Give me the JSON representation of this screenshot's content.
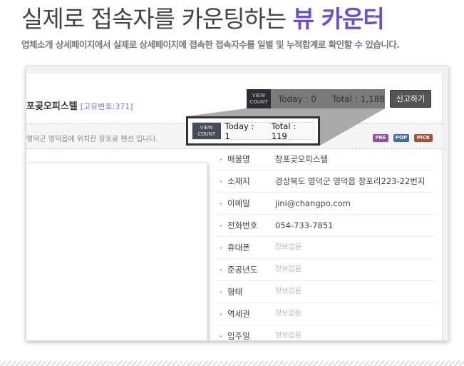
{
  "header": {
    "title_main": "실제로 접속자를 카운팅하는 ",
    "title_accent": "뷰 카운터",
    "subtitle": "업체소개 상세페이지에서 실제로 상세페이지에 접속한 접속자수를 일별 및 누적합계로 확인할 수 있습니다."
  },
  "listing": {
    "name": "포곶오피스텔",
    "id_label": "[고유번호:371]",
    "description": "영덕군 영덕읍에 위치한 창포곶 펜션 입니다.",
    "report_button": "신고하기",
    "badges": [
      {
        "label": "PRE",
        "color": "#8a4fb0"
      },
      {
        "label": "POP",
        "color": "#3d6ea8"
      },
      {
        "label": "PICK",
        "color": "#a0553a"
      }
    ]
  },
  "view_count": {
    "label_line1": "VIEW",
    "label_line2": "COUNT",
    "actual": {
      "today": "Today : 0",
      "total": "Total : 1,188"
    },
    "zoomed": {
      "today": "Today : 1",
      "total": "Total : 119"
    }
  },
  "info": [
    {
      "key": "매물명",
      "value": "창포곶오피스텔"
    },
    {
      "key": "소재지",
      "value": "경상북도 영덕군 영덕읍 창포리223-22번지"
    },
    {
      "key": "이메일",
      "value": "jini@changpo.com"
    },
    {
      "key": "전화번호",
      "value": "054-733-7851"
    },
    {
      "key": "휴대폰",
      "value": "정보없음",
      "empty": true
    },
    {
      "key": "준공년도",
      "value": "정보없음",
      "empty": true
    },
    {
      "key": "형태",
      "value": "정보없음",
      "empty": true
    },
    {
      "key": "역세권",
      "value": "정보없음",
      "empty": true
    },
    {
      "key": "입주일",
      "value": "정보없음",
      "empty": true
    }
  ]
}
